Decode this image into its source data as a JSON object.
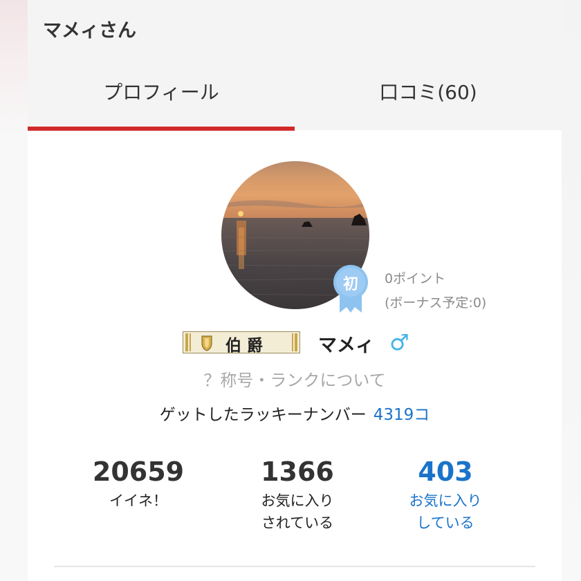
{
  "page": {
    "title": "マメィさん"
  },
  "tabs": [
    {
      "label": "プロフィール",
      "active": true
    },
    {
      "label": "口コミ(60)",
      "active": false
    }
  ],
  "profile": {
    "badge_text": "初",
    "points": "0ポイント",
    "bonus": "(ボーナス予定:0)",
    "rank_title": "伯爵",
    "username": "マメィ",
    "gender_symbol": "♂",
    "rank_link": "？称号・ランクについて",
    "lucky_label": "ゲットしたラッキーナンバー",
    "lucky_value": "4319コ"
  },
  "stats": [
    {
      "value": "20659",
      "label_line1": "イイネ！",
      "label_line2": ""
    },
    {
      "value": "1366",
      "label_line1": "お気に入り",
      "label_line2": "されている"
    },
    {
      "value": "403",
      "label_line1": "お気に入り",
      "label_line2": "している"
    }
  ],
  "colors": {
    "accent_red": "#d12a2a",
    "link_blue": "#1a73c9",
    "gender_blue": "#42b4e6",
    "badge_blue": "#8ec3f0"
  },
  "icons": {
    "avatar": "sunset-sea-photo",
    "badge": "beginner-ribbon-icon",
    "rank": "shield-crest-icon",
    "gender": "male-symbol-icon"
  }
}
